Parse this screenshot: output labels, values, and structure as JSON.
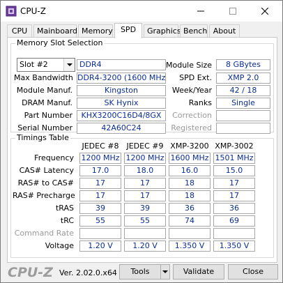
{
  "window": {
    "title": "CPU-Z"
  },
  "tabs": [
    {
      "label": "CPU"
    },
    {
      "label": "Mainboard"
    },
    {
      "label": "Memory"
    },
    {
      "label": "SPD"
    },
    {
      "label": "Graphics"
    },
    {
      "label": "Bench"
    },
    {
      "label": "About"
    }
  ],
  "memory_slot": {
    "group_title": "Memory Slot Selection",
    "slot_selected": "Slot #2",
    "type": "DDR4",
    "labels": {
      "max_bandwidth": "Max Bandwidth",
      "module_manuf": "Module Manuf.",
      "dram_manuf": "DRAM Manuf.",
      "part_number": "Part Number",
      "serial_number": "Serial Number",
      "module_size": "Module Size",
      "spd_ext": "SPD Ext.",
      "week_year": "Week/Year",
      "ranks": "Ranks",
      "correction": "Correction",
      "registered": "Registered"
    },
    "values": {
      "max_bandwidth": "DDR4-3200 (1600 MHz)",
      "module_manuf": "Kingston",
      "dram_manuf": "SK Hynix",
      "part_number": "KHX3200C16D4/8GX",
      "serial_number": "42A60C24",
      "module_size": "8 GBytes",
      "spd_ext": "XMP 2.0",
      "week_year": "42 / 18",
      "ranks": "Single",
      "correction": "",
      "registered": ""
    }
  },
  "timings": {
    "group_title": "Timings Table",
    "columns": [
      "JEDEC #8",
      "JEDEC #9",
      "XMP-3200",
      "XMP-3002"
    ],
    "rows": [
      {
        "label": "Frequency",
        "values": [
          "1200 MHz",
          "1200 MHz",
          "1600 MHz",
          "1501 MHz"
        ]
      },
      {
        "label": "CAS# Latency",
        "values": [
          "17.0",
          "18.0",
          "16.0",
          "15.0"
        ]
      },
      {
        "label": "RAS# to CAS#",
        "values": [
          "17",
          "17",
          "18",
          "17"
        ]
      },
      {
        "label": "RAS# Precharge",
        "values": [
          "17",
          "17",
          "18",
          "17"
        ]
      },
      {
        "label": "tRAS",
        "values": [
          "39",
          "39",
          "36",
          "36"
        ]
      },
      {
        "label": "tRC",
        "values": [
          "55",
          "55",
          "74",
          "69"
        ]
      },
      {
        "label": "Command Rate",
        "values": [
          "",
          "",
          "",
          ""
        ]
      },
      {
        "label": "Voltage",
        "values": [
          "1.20 V",
          "1.20 V",
          "1.350 V",
          "1.350 V"
        ]
      }
    ]
  },
  "footer": {
    "brand": "CPU-Z",
    "version": "Ver. 2.02.0.x64",
    "tools_label": "Tools",
    "validate_label": "Validate",
    "close_label": "Close"
  }
}
